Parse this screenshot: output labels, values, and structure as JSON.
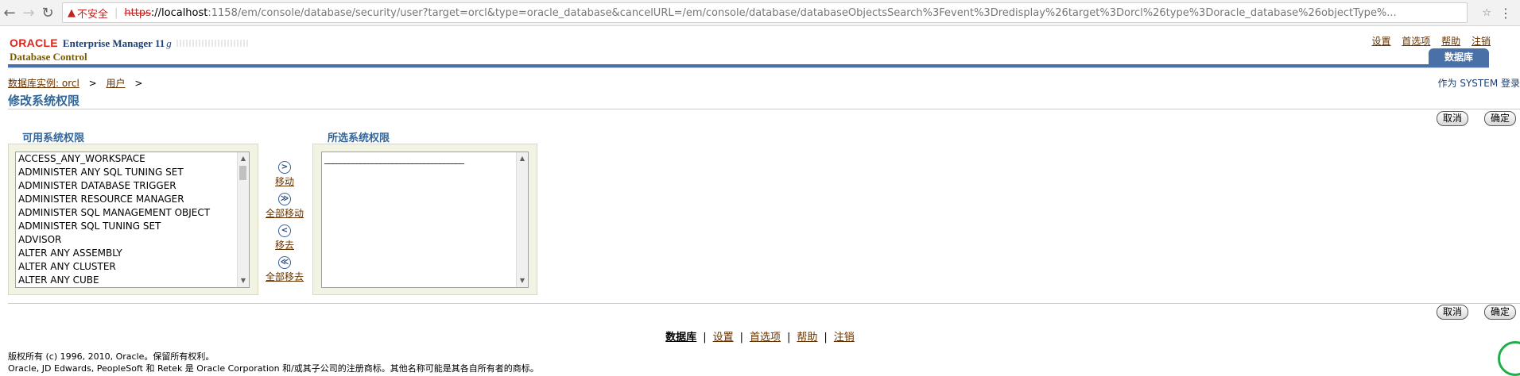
{
  "browser": {
    "back_icon": "back-arrow-icon",
    "insecure_label": "不安全",
    "url_scheme": "https",
    "url_host": "://localhost",
    "url_rest": ":1158/em/console/database/security/user?target=orcl&type=oracle_database&cancelURL=/em/console/database/databaseObjectsSearch%3Fevent%3Dredisplay%26target%3Dorcl%26type%3Doracle_database%26objectType%..."
  },
  "header": {
    "oracle": "ORACLE",
    "product": "Enterprise Manager 11",
    "product_version": "g",
    "subtitle": "Database Control",
    "links": [
      "设置",
      "首选项",
      "帮助",
      "注销"
    ],
    "tab": "数据库"
  },
  "breadcrumb": {
    "items": [
      "数据库实例: orcl",
      "用户"
    ],
    "separator": ">"
  },
  "login_as": "作为 SYSTEM 登录",
  "page_title": "修改系统权限",
  "buttons": {
    "cancel": "取消",
    "ok": "确定"
  },
  "available": {
    "label": "可用系统权限",
    "items": [
      "ACCESS_ANY_WORKSPACE",
      "ADMINISTER ANY SQL TUNING SET",
      "ADMINISTER DATABASE TRIGGER",
      "ADMINISTER RESOURCE MANAGER",
      "ADMINISTER SQL MANAGEMENT OBJECT",
      "ADMINISTER SQL TUNING SET",
      "ADVISOR",
      "ALTER ANY ASSEMBLY",
      "ALTER ANY CLUSTER",
      "ALTER ANY CUBE"
    ]
  },
  "movers": [
    {
      "symbol": ">",
      "label": "移动"
    },
    {
      "symbol": "≫",
      "label": "全部移动"
    },
    {
      "symbol": "<",
      "label": "移去"
    },
    {
      "symbol": "≪",
      "label": "全部移去"
    }
  ],
  "selected": {
    "label": "所选系统权限",
    "placeholder": "___________________________________"
  },
  "footer": {
    "links": [
      "数据库",
      "设置",
      "首选项",
      "帮助",
      "注销"
    ],
    "copyright": "版权所有 (c) 1996, 2010, Oracle。保留所有权利。",
    "trademark": "Oracle, JD Edwards, PeopleSoft 和 Retek 是 Oracle Corporation 和/或其子公司的注册商标。其他名称可能是其各自所有者的商标。"
  }
}
